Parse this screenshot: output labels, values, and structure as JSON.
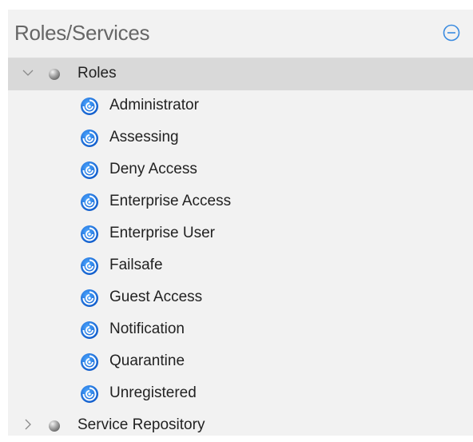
{
  "panel": {
    "title": "Roles/Services",
    "collapse_icon": "minus-circle-icon"
  },
  "tree": {
    "roles_node": {
      "label": "Roles",
      "expanded": true,
      "selected": true,
      "toggle_icon": "chevron-down-icon",
      "node_icon": "gray-sphere-icon"
    },
    "roles": [
      {
        "label": "Administrator",
        "icon": "role-swirl-icon"
      },
      {
        "label": "Assessing",
        "icon": "role-swirl-icon"
      },
      {
        "label": "Deny Access",
        "icon": "role-swirl-icon"
      },
      {
        "label": "Enterprise Access",
        "icon": "role-swirl-icon"
      },
      {
        "label": "Enterprise User",
        "icon": "role-swirl-icon"
      },
      {
        "label": "Failsafe",
        "icon": "role-swirl-icon"
      },
      {
        "label": "Guest Access",
        "icon": "role-swirl-icon"
      },
      {
        "label": "Notification",
        "icon": "role-swirl-icon"
      },
      {
        "label": "Quarantine",
        "icon": "role-swirl-icon"
      },
      {
        "label": "Unregistered",
        "icon": "role-swirl-icon"
      }
    ],
    "service_node": {
      "label": "Service Repository",
      "expanded": false,
      "toggle_icon": "chevron-right-icon",
      "node_icon": "gray-sphere-icon"
    }
  },
  "colors": {
    "panel_bg": "#f2f2f2",
    "selected_bg": "#d9d9d9",
    "accent_blue": "#1a6fd1",
    "title_text": "#666666"
  }
}
